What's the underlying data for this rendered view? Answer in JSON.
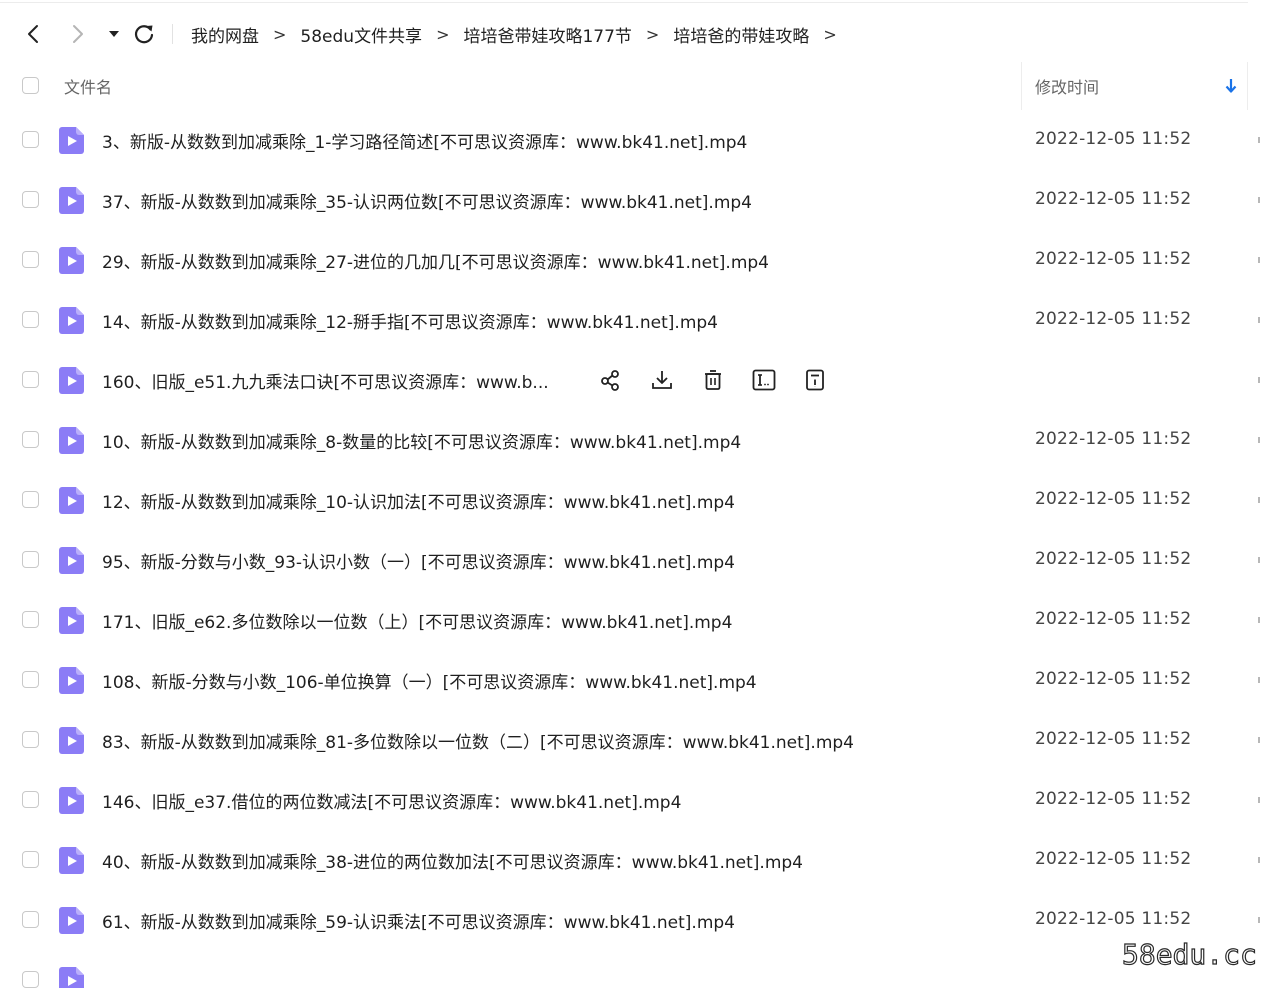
{
  "breadcrumb": [
    "我的网盘",
    "58edu文件共享",
    "培培爸带娃攻略177节",
    "培培爸的带娃攻略"
  ],
  "breadcrumb_separator": ">",
  "header": {
    "name_label": "文件名",
    "time_label": "修改时间"
  },
  "icons": {
    "back": "chevron-left-icon",
    "forward": "chevron-right-icon",
    "history_dropdown": "caret-down-icon",
    "refresh": "refresh-icon",
    "sort": "arrow-down-icon",
    "file": "video-file-icon",
    "share": "share-icon",
    "download": "download-icon",
    "delete": "trash-icon",
    "rename": "rename-icon",
    "more": "more-icon"
  },
  "colors": {
    "accent": "#1a73e8",
    "file_icon": "#8b7cf6"
  },
  "files": [
    {
      "name": "3、新版-从数数到加减乘除_1-学习路径简述[不可思议资源库：www.bk41.net].mp4",
      "time": "2022-12-05 11:52"
    },
    {
      "name": "37、新版-从数数到加减乘除_35-认识两位数[不可思议资源库：www.bk41.net].mp4",
      "time": "2022-12-05 11:52"
    },
    {
      "name": "29、新版-从数数到加减乘除_27-进位的几加几[不可思议资源库：www.bk41.net].mp4",
      "time": "2022-12-05 11:52"
    },
    {
      "name": "14、新版-从数数到加减乘除_12-掰手指[不可思议资源库：www.bk41.net].mp4",
      "time": "2022-12-05 11:52"
    },
    {
      "name": "160、旧版_e51.九九乘法口诀[不可思议资源库：www.b...",
      "time": "",
      "hovered": true
    },
    {
      "name": "10、新版-从数数到加减乘除_8-数量的比较[不可思议资源库：www.bk41.net].mp4",
      "time": "2022-12-05 11:52"
    },
    {
      "name": "12、新版-从数数到加减乘除_10-认识加法[不可思议资源库：www.bk41.net].mp4",
      "time": "2022-12-05 11:52"
    },
    {
      "name": "95、新版-分数与小数_93-认识小数（一）[不可思议资源库：www.bk41.net].mp4",
      "time": "2022-12-05 11:52"
    },
    {
      "name": "171、旧版_e62.多位数除以一位数（上）[不可思议资源库：www.bk41.net].mp4",
      "time": "2022-12-05 11:52"
    },
    {
      "name": "108、新版-分数与小数_106-单位换算（一）[不可思议资源库：www.bk41.net].mp4",
      "time": "2022-12-05 11:52"
    },
    {
      "name": "83、新版-从数数到加减乘除_81-多位数除以一位数（二）[不可思议资源库：www.bk41.net].mp4",
      "time": "2022-12-05 11:52"
    },
    {
      "name": "146、旧版_e37.借位的两位数减法[不可思议资源库：www.bk41.net].mp4",
      "time": "2022-12-05 11:52"
    },
    {
      "name": "40、新版-从数数到加减乘除_38-进位的两位数加法[不可思议资源库：www.bk41.net].mp4",
      "time": "2022-12-05 11:52"
    },
    {
      "name": "61、新版-从数数到加减乘除_59-认识乘法[不可思议资源库：www.bk41.net].mp4",
      "time": "2022-12-05 11:52"
    },
    {
      "name": "",
      "time": "",
      "partial": true
    }
  ],
  "watermark": "58edu.cc"
}
